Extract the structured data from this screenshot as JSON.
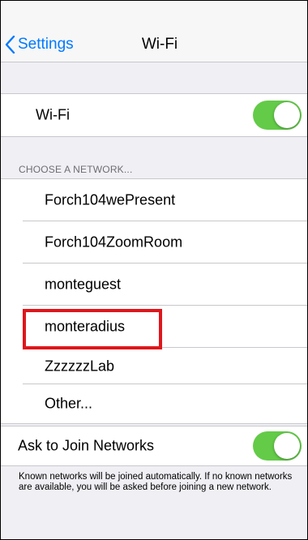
{
  "nav": {
    "back_label": "Settings",
    "title": "Wi-Fi"
  },
  "wifi": {
    "label": "Wi-Fi",
    "enabled": true
  },
  "networks": {
    "header": "CHOOSE A NETWORK...",
    "items": [
      "Forch104wePresent",
      "Forch104ZoomRoom",
      "monteguest",
      "monteradius",
      "ZzzzzzLab",
      "Other..."
    ],
    "highlighted": "monteradius"
  },
  "ask_to_join": {
    "label": "Ask to Join Networks",
    "enabled": true,
    "footer": "Known networks will be joined automatically. If no known networks are available, you will be asked before joining a new network."
  },
  "colors": {
    "accent": "#007aff",
    "toggle_on": "#63cb48",
    "highlight": "#e0161b",
    "background": "#efeff4"
  }
}
